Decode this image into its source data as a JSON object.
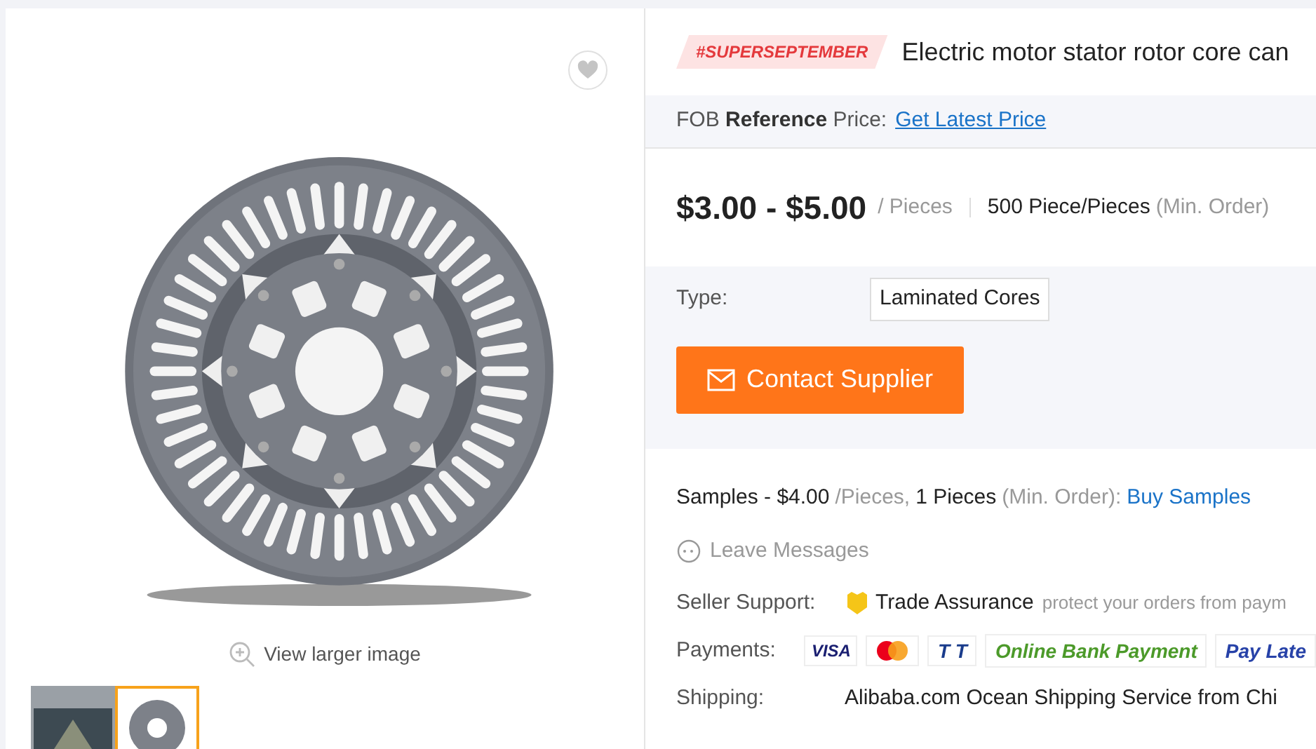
{
  "gallery": {
    "favorite": {
      "selected": false
    },
    "zoom_link": "View larger image",
    "thumbnails": [
      {
        "kind": "factory",
        "selected": false
      },
      {
        "kind": "stator",
        "selected": true
      }
    ]
  },
  "product": {
    "tag": "#SUPERSEPTEMBER",
    "title": "Electric motor stator rotor core can",
    "reference": {
      "prefix": "FOB ",
      "bold": "Reference",
      "suffix": " Price:",
      "link": "Get Latest Price"
    },
    "price": {
      "range": "$3.00 - $5.00",
      "unit": "/ Pieces",
      "moq": "500 Piece/Pieces",
      "moq_note": "(Min. Order)"
    },
    "attributes": [
      {
        "label": "Type:",
        "value": "Laminated Cores"
      }
    ],
    "contact_button": "Contact Supplier",
    "samples": {
      "text": "Samples - $4.00",
      "unit": "/Pieces,",
      "qty": "1 Pieces",
      "note": "(Min. Order):",
      "link": "Buy Samples"
    },
    "leave_messages": "Leave Messages",
    "seller_support": {
      "label": "Seller Support:",
      "service": "Trade Assurance",
      "note": "protect your orders from paym"
    },
    "payments": {
      "label": "Payments:",
      "methods": [
        {
          "kind": "visa",
          "text": "VISA"
        },
        {
          "kind": "mastercard"
        },
        {
          "kind": "tt",
          "text": "T T"
        },
        {
          "kind": "online",
          "text": "Online Bank Payment"
        },
        {
          "kind": "later",
          "text": "Pay Late"
        }
      ]
    },
    "shipping": {
      "label": "Shipping:",
      "value": "Alibaba.com Ocean Shipping Service from Chi"
    }
  }
}
